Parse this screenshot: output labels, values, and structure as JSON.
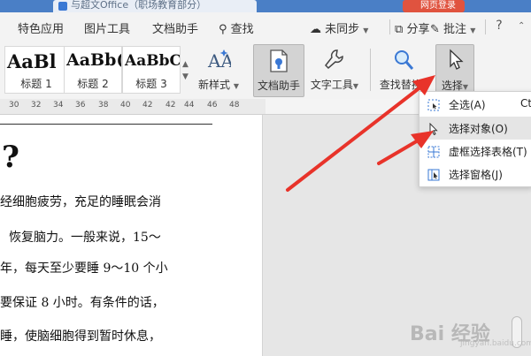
{
  "titlebar": {
    "tab_text": "与超文Office（职场教育部分）",
    "badge_text": "网页登录"
  },
  "menu": {
    "items": [
      "特色应用",
      "图片工具",
      "文档助手",
      "查找"
    ],
    "sync": "未同步",
    "share": "分享",
    "comment": "批注",
    "help": "?"
  },
  "ribbon": {
    "styles": [
      {
        "preview": "AaBl",
        "caption": "标题 1"
      },
      {
        "preview": "AaBb(",
        "caption": "标题 2"
      },
      {
        "preview": "AaBbC",
        "caption": "标题 3"
      }
    ],
    "new_style": "新样式",
    "doc_helper": "文档助手",
    "text_tools": "文字工具",
    "find_replace": "查找替换",
    "select": "选择"
  },
  "ruler": {
    "ticks": [
      "30",
      "32",
      "34",
      "36",
      "38",
      "40",
      "42",
      "44",
      "46",
      "48"
    ]
  },
  "document": {
    "qmark": "?",
    "lines": [
      "经细胞疲劳，充足的睡眠会消",
      "恢复脑力。一般来说，15～",
      "年，每天至少要睡 9～10 个小",
      "要保证 8 小时。有条件的话，",
      "睡，使脑细胞得到暂时休息，"
    ]
  },
  "dropdown": {
    "items": [
      {
        "label": "全选(A)",
        "shortcut": "Ctrl"
      },
      {
        "label": "选择对象(O)",
        "shortcut": ""
      },
      {
        "label": "虚框选择表格(T)",
        "shortcut": ""
      },
      {
        "label": "选择窗格(J)",
        "shortcut": ""
      }
    ]
  },
  "watermark": {
    "main": "Bai 经验",
    "sub": "jingyan.baidu.com"
  },
  "colors": {
    "accent": "#4a7fc6",
    "arrow": "#e8332a",
    "badge": "#e0533f"
  }
}
